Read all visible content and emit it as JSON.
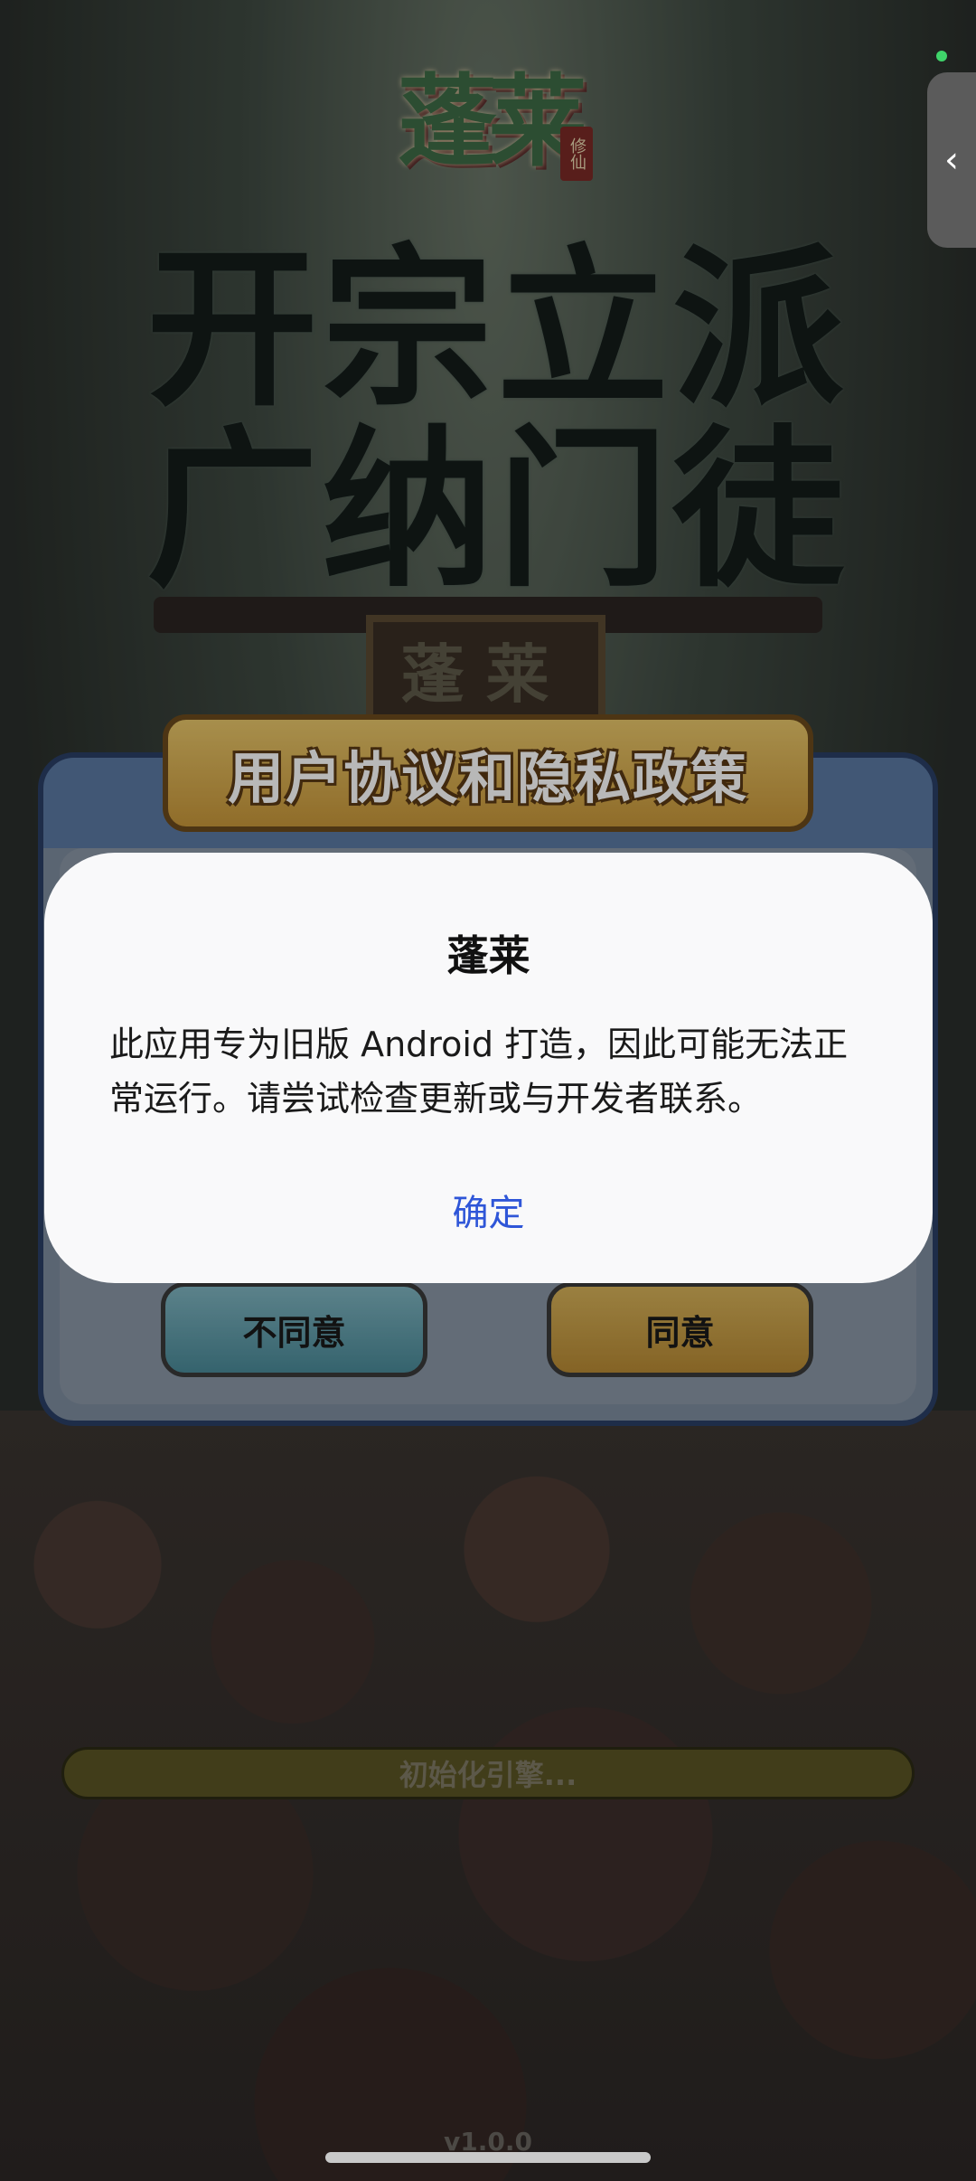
{
  "app": {
    "logo_text": "蓬莱",
    "logo_seal": "修仙",
    "slogan_line1": "开宗立派",
    "slogan_line2": "广纳门徒",
    "gate_plaque": "蓬莱"
  },
  "game_dialog": {
    "title": "用户协议和隐私政策",
    "disagree_label": "不同意",
    "agree_label": "同意"
  },
  "loading": {
    "text": "初始化引擎...",
    "version": "v1.0.0"
  },
  "alert": {
    "title": "蓬莱",
    "message": "此应用专为旧版 Android 打造，因此可能无法正常运行。请尝试检查更新或与开发者联系。",
    "confirm_label": "确定"
  },
  "side_tab": {
    "icon": "chevron-left-icon",
    "glyph": "‹"
  },
  "colors": {
    "accent": "#2f56d8",
    "status_dot": "#3fd46a"
  }
}
